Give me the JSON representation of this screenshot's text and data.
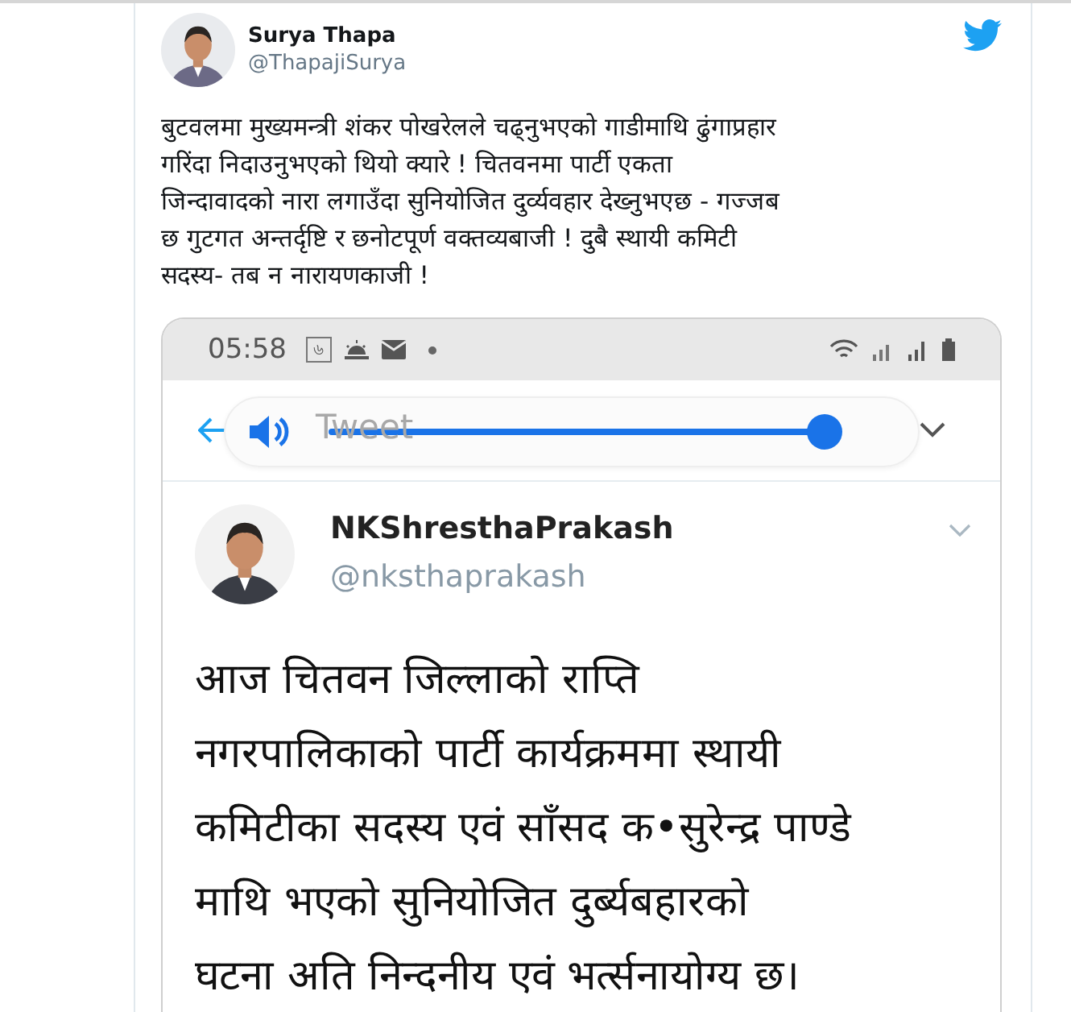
{
  "tweet": {
    "author": {
      "name": "Surya Thapa",
      "handle": "@ThapajiSurya"
    },
    "text_lines": [
      "बुटवलमा मुख्यमन्त्री शंकर पोखरेलले चढ्नुभएको गाडीमाथि ढुंगाप्रहार",
      "गरिंदा  निदाउनुभएको थियो क्यारे ! चितवनमा पार्टी एकता",
      "जिन्दावादको नारा लगाउँदा सुनियोजित दुर्व्यवहार देख्नुभएछ - गज्जब",
      "छ गुटगत अन्तर्दृष्टि र छनोटपूर्ण वक्तव्यबाजी ! दुबै स्थायी कमिटी",
      "सदस्य- तब न नारायणकाजी !"
    ]
  },
  "screenshot": {
    "status_bar": {
      "time": "05:58",
      "app_badge": "৬"
    },
    "header": {
      "title": "Tweet",
      "volume": {
        "level": 1.0
      }
    },
    "quoted": {
      "name": "NKShresthaPrakash",
      "handle": "@nksthaprakash",
      "text_lines": [
        "आज चितवन जिल्लाको राप्ति",
        "नगरपालिकाको पार्टी कार्यक्रममा स्थायी",
        "कमिटीका सदस्य एवं साँसद क•सुरेन्द्र पाण्डे",
        "माथि भएको सुनियोजित दुर्ब्यबहारको",
        "घटना अति निन्दनीय एवं भर्त्सनायोग्य छ।"
      ]
    }
  }
}
